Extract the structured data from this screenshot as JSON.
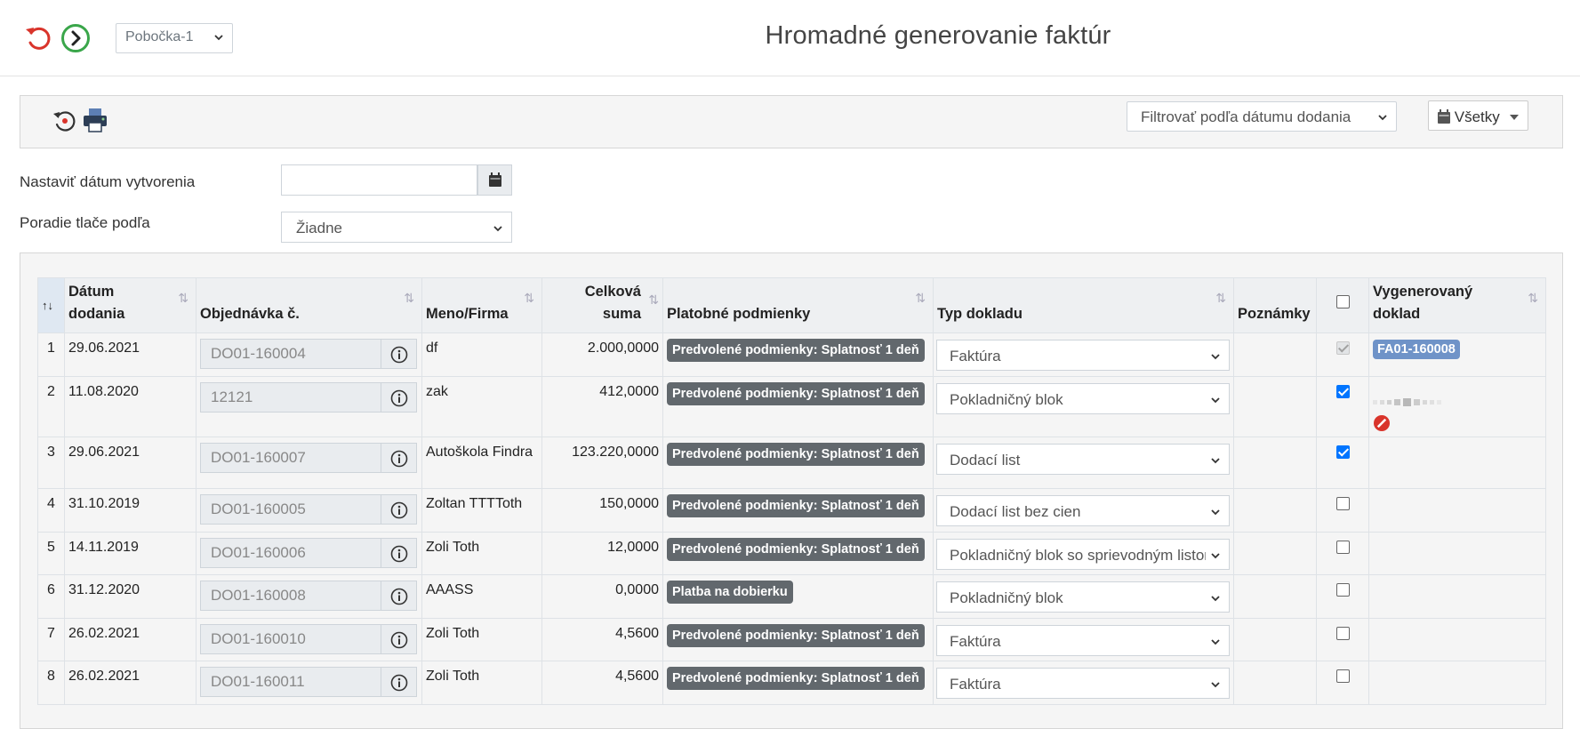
{
  "header": {
    "title": "Hromadné generovanie faktúr",
    "branch": "Pobočka-1"
  },
  "toolbar": {
    "delivery_filter": "Filtrovať podľa dátumu dodania",
    "all_button": "Všetky"
  },
  "form": {
    "creation_date_label": "Nastaviť dátum vytvorenia",
    "creation_date_value": "",
    "print_order_label": "Poradie tlače podľa",
    "print_order_value": "Žiadne"
  },
  "table": {
    "headers": {
      "index": "↑↓",
      "delivery_date": [
        "Dátum",
        "dodania"
      ],
      "order_no": "Objednávka č.",
      "name": "Meno/Firma",
      "total": [
        "Celková",
        "suma"
      ],
      "payment": "Platobné podmienky",
      "doc_type": "Typ dokladu",
      "notes": "Poznámky",
      "generated": [
        "Vygenerovaný",
        "doklad"
      ]
    },
    "rows": [
      {
        "n": "1",
        "date": "29.06.2021",
        "order": "DO01-160004",
        "name": "df",
        "total": "2.000,0000",
        "payment": "Predvolené podmienky: Splatnosť 1 deň",
        "doc_type": "Faktúra",
        "checked": true,
        "disabled": true,
        "generated": "FA01-160008"
      },
      {
        "n": "2",
        "date": "11.08.2020",
        "order": "12121",
        "name": "zak",
        "total": "412,0000",
        "payment": "Predvolené podmienky: Splatnosť 1 deň",
        "doc_type": "Pokladničný blok",
        "checked": true,
        "disabled": false,
        "generated": ""
      },
      {
        "n": "3",
        "date": "29.06.2021",
        "order": "DO01-160007",
        "name": "Autoškola Findra",
        "total": "123.220,0000",
        "payment": "Predvolené podmienky: Splatnosť 1 deň",
        "doc_type": "Dodací list",
        "checked": true,
        "disabled": false,
        "generated": ""
      },
      {
        "n": "4",
        "date": "31.10.2019",
        "order": "DO01-160005",
        "name": "Zoltan TTTToth",
        "total": "150,0000",
        "payment": "Predvolené podmienky: Splatnosť 1 deň",
        "doc_type": "Dodací list bez cien",
        "checked": false,
        "disabled": false,
        "generated": ""
      },
      {
        "n": "5",
        "date": "14.11.2019",
        "order": "DO01-160006",
        "name": "Zoli Toth",
        "total": "12,0000",
        "payment": "Predvolené podmienky: Splatnosť 1 deň",
        "doc_type": "Pokladničný blok so sprievodným listom",
        "checked": false,
        "disabled": false,
        "generated": ""
      },
      {
        "n": "6",
        "date": "31.12.2020",
        "order": "DO01-160008",
        "name": "AAASS",
        "total": "0,0000",
        "payment": "Platba na dobierku",
        "doc_type": "Pokladničný blok",
        "checked": false,
        "disabled": false,
        "generated": ""
      },
      {
        "n": "7",
        "date": "26.02.2021",
        "order": "DO01-160010",
        "name": "Zoli Toth",
        "total": "4,5600",
        "payment": "Predvolené podmienky: Splatnosť 1 deň",
        "doc_type": "Faktúra",
        "checked": false,
        "disabled": false,
        "generated": ""
      },
      {
        "n": "8",
        "date": "26.02.2021",
        "order": "DO01-160011",
        "name": "Zoli Toth",
        "total": "4,5600",
        "payment": "Predvolené podmienky: Splatnosť 1 deň",
        "doc_type": "Faktúra",
        "checked": false,
        "disabled": false,
        "generated": ""
      }
    ]
  },
  "icons": {
    "undo": "undo-icon",
    "next": "arrow-right-circle-icon",
    "reset": "history-icon",
    "print": "printer-icon",
    "calendar": "calendar-icon",
    "info": "info-icon",
    "sort": "sort-icon",
    "cancel": "ban-icon",
    "loading": "loading-icon"
  },
  "colors": {
    "undo": "#d9342b",
    "next": "#3aa64a",
    "payment_badge": "#62686d",
    "generated_badge": "#6f93c8",
    "checkbox": "#0075ff",
    "cancel": "#d9342b"
  }
}
